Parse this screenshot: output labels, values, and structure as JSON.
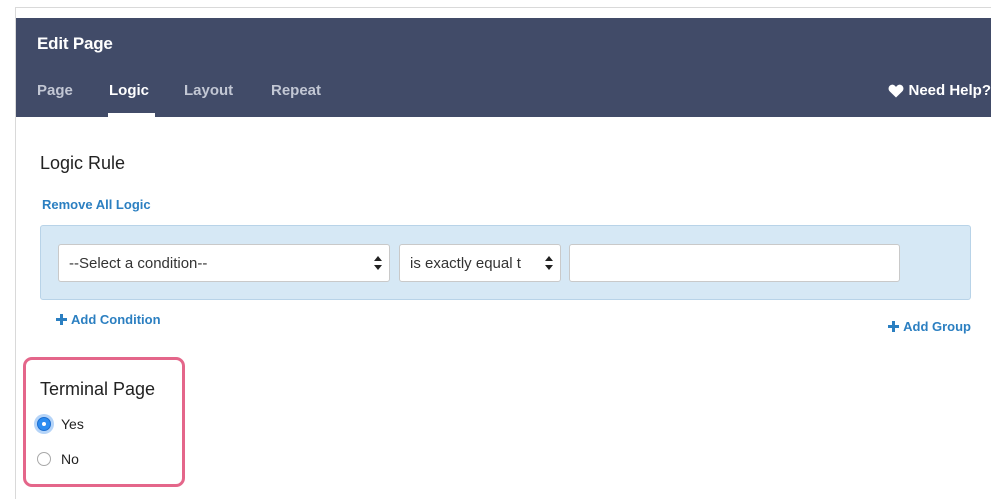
{
  "header": {
    "title": "Edit Page",
    "help_label": "Need Help?",
    "help_icon": "heart-icon"
  },
  "tabs": [
    {
      "label": "Page",
      "active": false
    },
    {
      "label": "Logic",
      "active": true
    },
    {
      "label": "Layout",
      "active": false
    },
    {
      "label": "Repeat",
      "active": false
    }
  ],
  "logic": {
    "section_title": "Logic Rule",
    "remove_all_label": "Remove All Logic",
    "condition_select": "--Select a condition--",
    "operator_select": "is exactly equal t",
    "value_input": "",
    "add_condition_label": "Add Condition",
    "add_group_label": "Add Group"
  },
  "terminal": {
    "title": "Terminal Page",
    "options": [
      {
        "label": "Yes",
        "selected": true
      },
      {
        "label": "No",
        "selected": false
      }
    ]
  },
  "colors": {
    "header_bg": "#414b68",
    "link": "#2b7fc1",
    "rule_box_bg": "#d6e8f5",
    "highlight_border": "#e4668a",
    "radio_selected": "#2c8cf0"
  }
}
